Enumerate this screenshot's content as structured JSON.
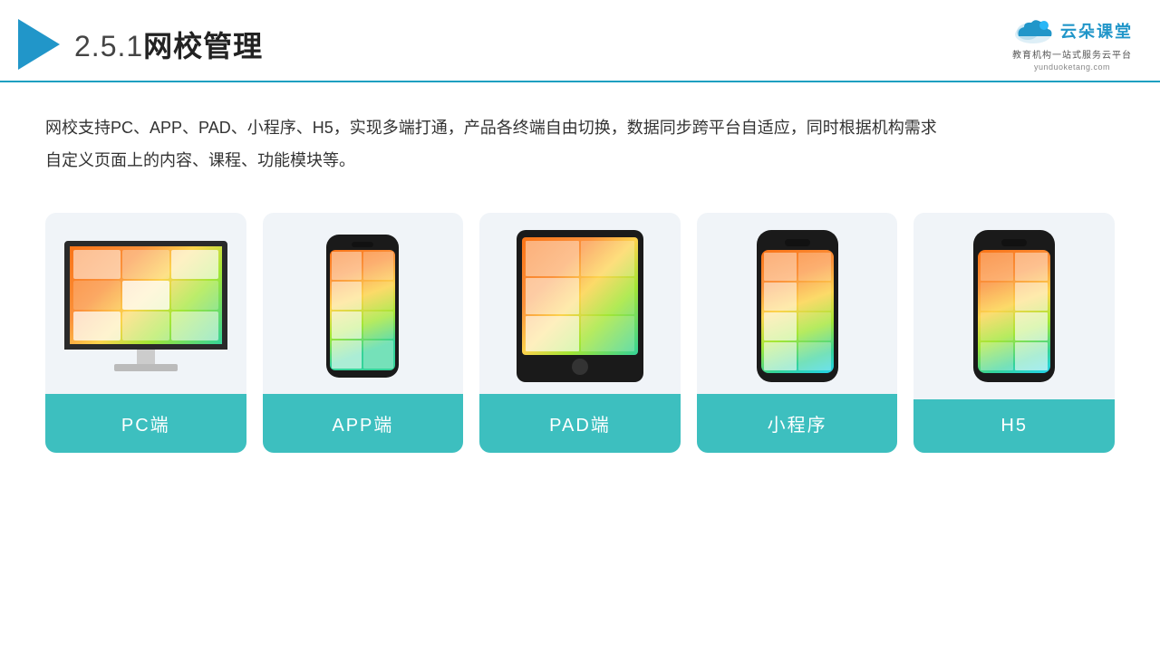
{
  "header": {
    "title_prefix": "2.5.1",
    "title_main": "网校管理",
    "logo_cn": "云朵课堂",
    "logo_url": "yunduoketang.com",
    "logo_tagline1": "教育机构一站",
    "logo_tagline2": "式服务云平台"
  },
  "description": {
    "text": "网校支持PC、APP、PAD、小程序、H5，实现多端打通，产品各终端自由切换，数据同步跨平台自适应，同时根据机构需求自定义页面上的内容、课程、功能模块等。"
  },
  "cards": [
    {
      "id": "pc",
      "label": "PC端",
      "type": "pc"
    },
    {
      "id": "app",
      "label": "APP端",
      "type": "app"
    },
    {
      "id": "pad",
      "label": "PAD端",
      "type": "pad"
    },
    {
      "id": "mini",
      "label": "小程序",
      "type": "phone"
    },
    {
      "id": "h5",
      "label": "H5",
      "type": "phone2"
    }
  ]
}
